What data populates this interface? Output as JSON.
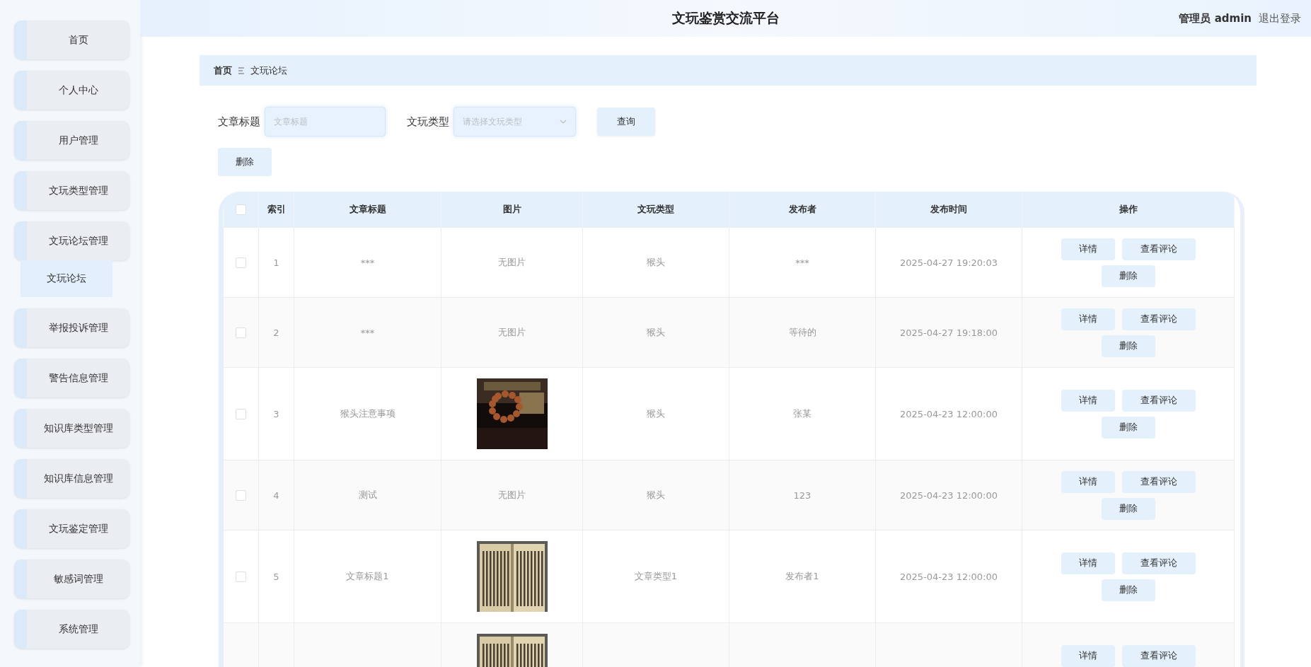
{
  "header": {
    "title": "文玩鉴赏交流平台",
    "user": "管理员 admin",
    "logout": "退出登录"
  },
  "sidebar": {
    "items": [
      {
        "label": "首页",
        "selected": false
      },
      {
        "label": "个人中心",
        "selected": false
      },
      {
        "label": "用户管理",
        "selected": false
      },
      {
        "label": "文玩类型管理",
        "selected": false
      },
      {
        "label": "文玩论坛管理",
        "selected": false,
        "children": [
          {
            "label": "文玩论坛",
            "selected": true
          }
        ]
      },
      {
        "label": "举报投诉管理",
        "selected": false
      },
      {
        "label": "警告信息管理",
        "selected": false
      },
      {
        "label": "知识库类型管理",
        "selected": false
      },
      {
        "label": "知识库信息管理",
        "selected": false
      },
      {
        "label": "文玩鉴定管理",
        "selected": false
      },
      {
        "label": "敏感词管理",
        "selected": false
      },
      {
        "label": "系统管理",
        "selected": false
      }
    ]
  },
  "breadcrumb": [
    "首页",
    "文玩论坛"
  ],
  "search": {
    "fields": [
      {
        "kind": "input",
        "label": "文章标题",
        "placeholder": "文章标题"
      },
      {
        "kind": "select",
        "label": "文玩类型",
        "placeholder": "请选择文玩类型"
      }
    ],
    "button": "查询"
  },
  "delete_button": "删除",
  "table": {
    "header_checked": false,
    "columns": [
      "索引",
      "文章标题",
      "图片",
      "文玩类型",
      "发布者",
      "发布时间",
      "操作"
    ],
    "rows": [
      {
        "checked": false,
        "index": "1",
        "title": "***",
        "image": {
          "kind": "none",
          "text": "无图片"
        },
        "type": "猴头",
        "author": "***",
        "time": "2025-04-27 19:20:03",
        "actions": [
          "详情",
          "查看评论",
          "删除"
        ]
      },
      {
        "checked": false,
        "index": "2",
        "title": "***",
        "image": {
          "kind": "none",
          "text": "无图片"
        },
        "type": "猴头",
        "author": "等待的",
        "time": "2025-04-27 19:18:00",
        "actions": [
          "详情",
          "查看评论",
          "删除"
        ]
      },
      {
        "checked": false,
        "index": "3",
        "title": "猴头注意事项",
        "image": {
          "kind": "picture"
        },
        "type": "猴头",
        "author": "张某",
        "time": "2025-04-23 12:00:00",
        "actions": [
          "详情",
          "查看评论",
          "删除"
        ]
      },
      {
        "checked": false,
        "index": "4",
        "title": "测试",
        "image": {
          "kind": "none",
          "text": "无图片"
        },
        "type": "猴头",
        "author": "123",
        "time": "2025-04-23 12:00:00",
        "actions": [
          "详情",
          "查看评论",
          "删除"
        ]
      },
      {
        "checked": false,
        "index": "5",
        "title": "文章标题1",
        "image": {
          "kind": "picture"
        },
        "type": "文章类型1",
        "author": "发布者1",
        "time": "2025-04-23 12:00:00",
        "actions": [
          "详情",
          "查看评论",
          "删除"
        ]
      },
      {
        "image": {
          "kind": "picture"
        },
        "actions": [
          "详情",
          "查看评论"
        ]
      }
    ]
  }
}
